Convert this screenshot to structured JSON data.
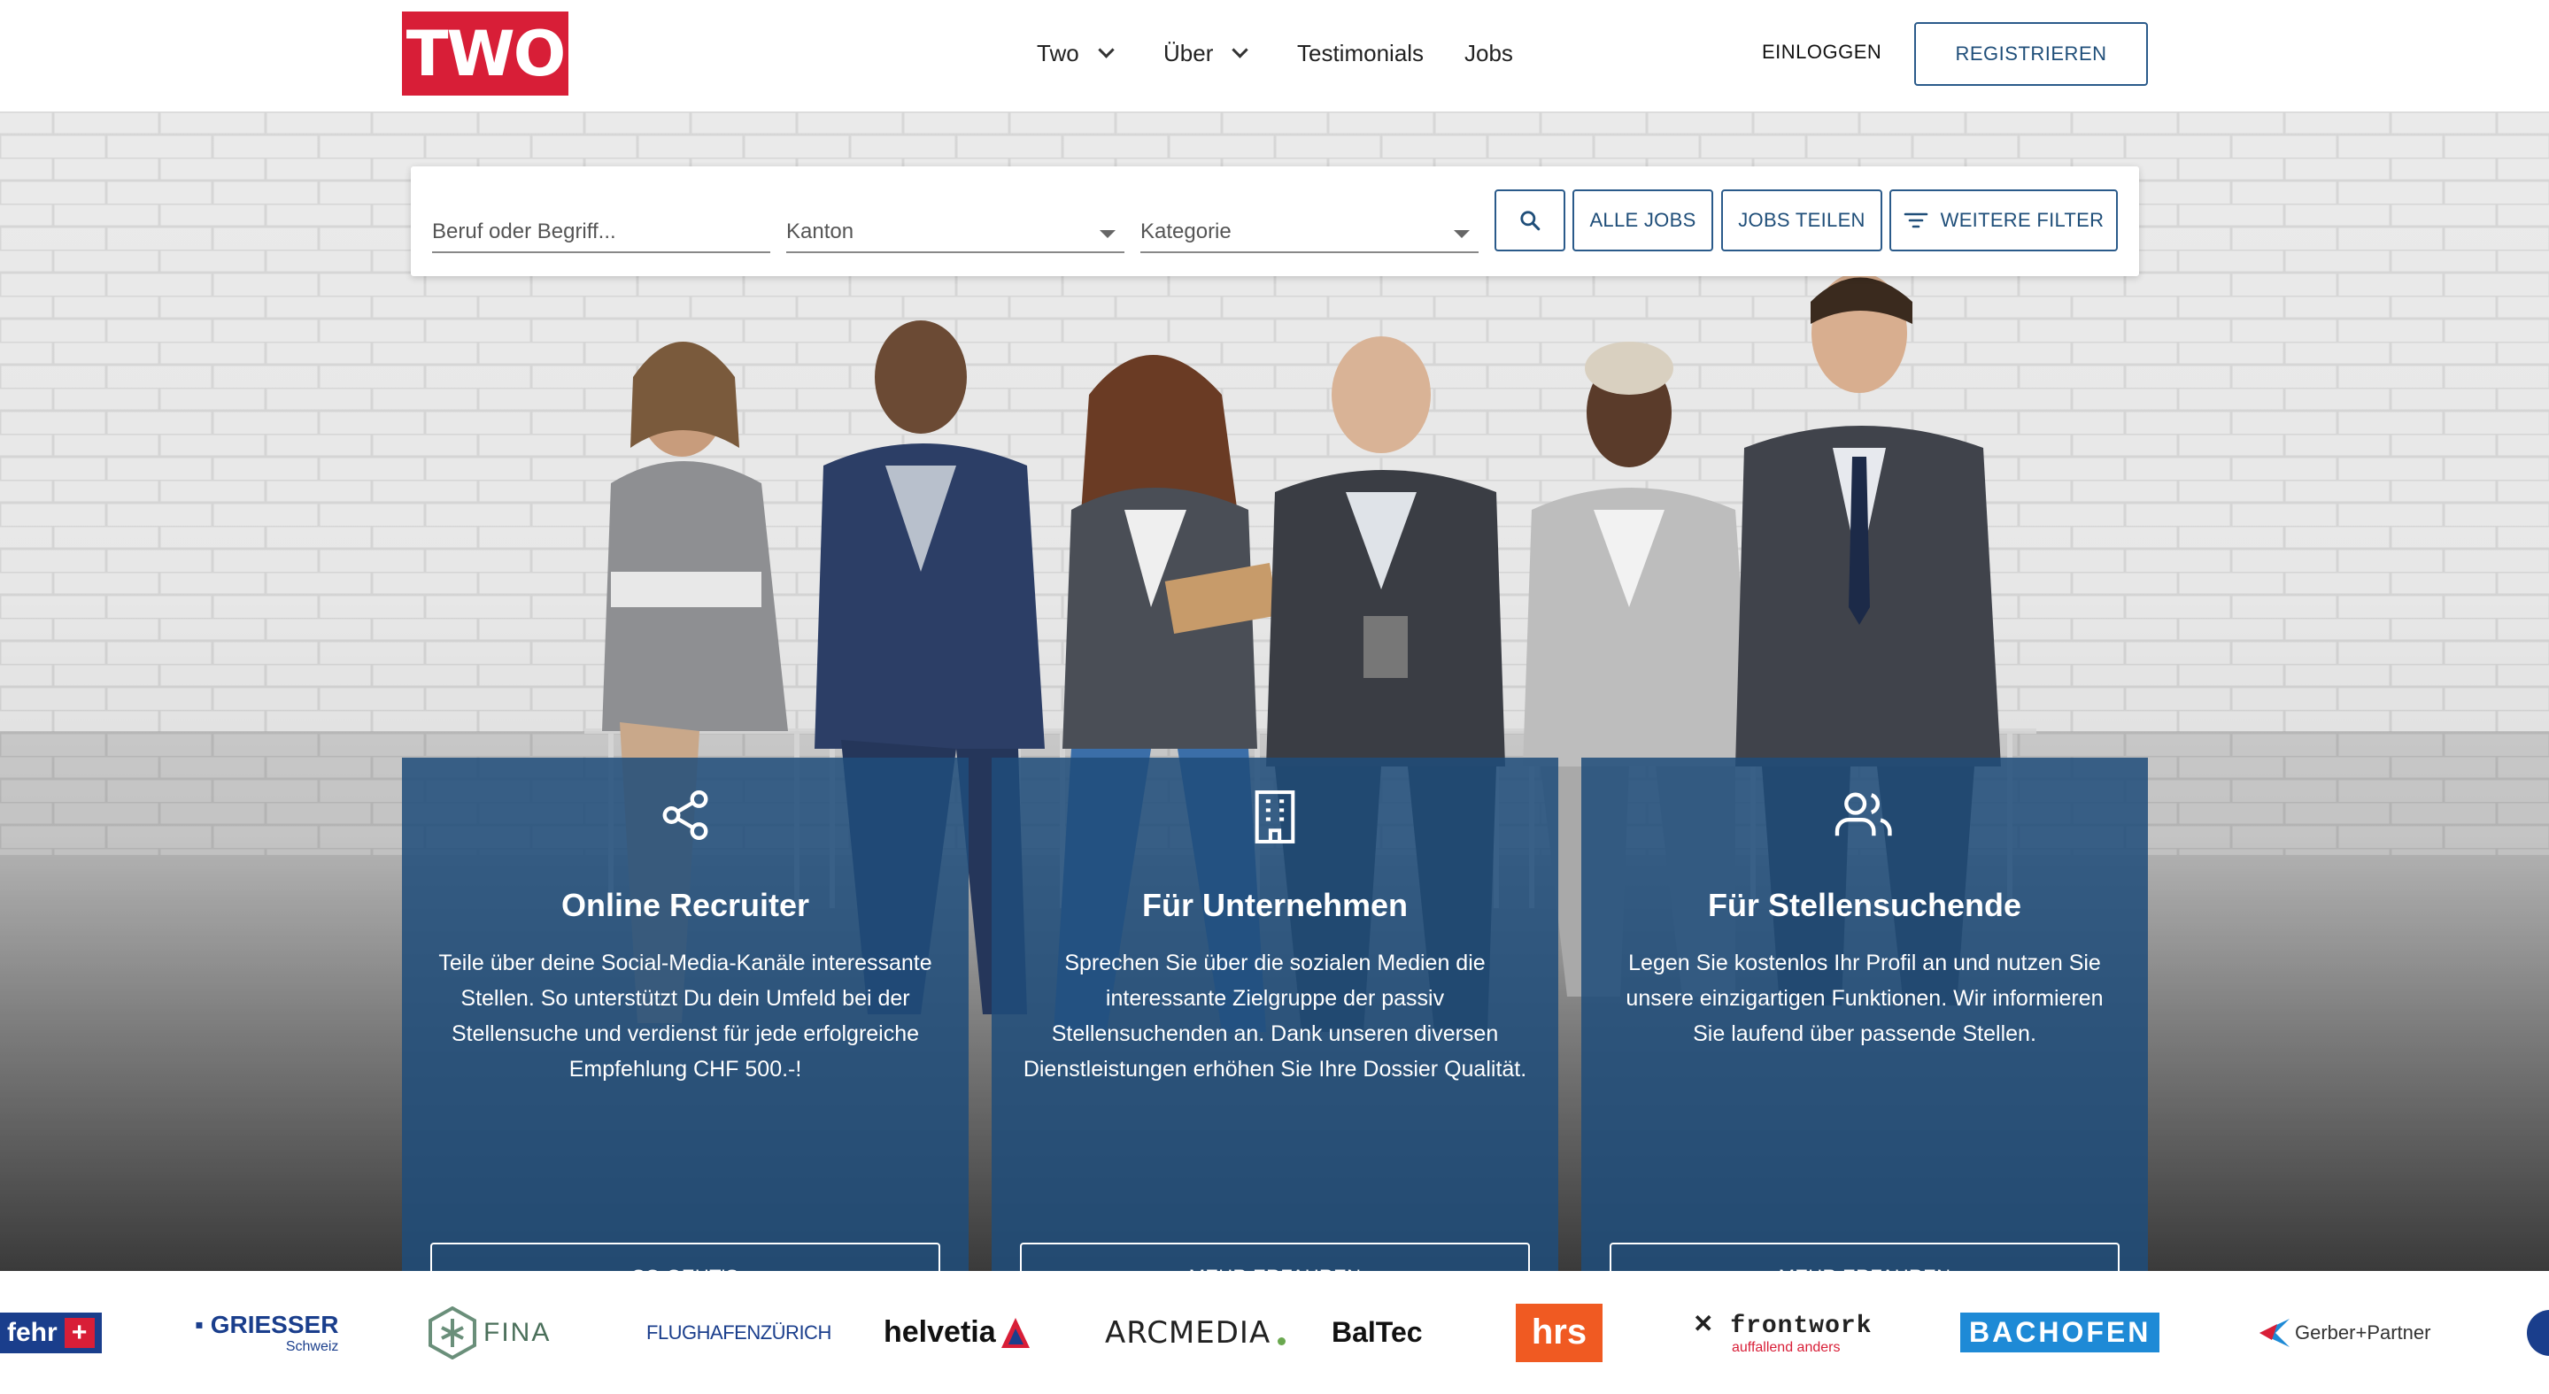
{
  "header": {
    "logo_text": "TWO",
    "nav": [
      {
        "label": "Two",
        "dropdown": true
      },
      {
        "label": "Über",
        "dropdown": true
      },
      {
        "label": "Testimonials",
        "dropdown": false
      },
      {
        "label": "Jobs",
        "dropdown": false
      }
    ],
    "login_label": "EINLOGGEN",
    "register_label": "REGISTRIEREN"
  },
  "search": {
    "keyword_placeholder": "Beruf oder Begriff...",
    "kanton_label": "Kanton",
    "kategorie_label": "Kategorie",
    "search_icon": "search-icon",
    "all_jobs_label": "ALLE JOBS",
    "share_jobs_label": "JOBS TEILEN",
    "more_filters_label": "WEITERE FILTER",
    "filter_icon": "filter-icon"
  },
  "cards": [
    {
      "icon": "share-icon",
      "title": "Online Recruiter",
      "text": "Teile über deine Social-Media-Kanäle interessante Stellen. So unterstützt Du dein Umfeld bei der Stellensuche und verdienst für jede erfolgreiche Empfehlung CHF 500.-!",
      "button": "SO GEHT'S"
    },
    {
      "icon": "building-icon",
      "title": "Für Unternehmen",
      "text": "Sprechen Sie über die sozialen Medien die interessante Zielgruppe der passiv Stellensuchenden an. Dank unseren diversen Dienstleistungen erhöhen Sie Ihre Dossier Qualität.",
      "button": "MEHR ERFAHREN"
    },
    {
      "icon": "users-icon",
      "title": "Für Stellensuchende",
      "text": "Legen Sie kostenlos Ihr Profil an und nutzen Sie unsere einzigartigen Funktionen. Wir informieren Sie laufend über passende Stellen.",
      "button": "MEHR ERFAHREN"
    }
  ],
  "partners": {
    "fehr": "fehr",
    "griesser": "GRIESSER",
    "griesser_sub": "Schweiz",
    "fina": "FINA",
    "flughafen": "FLUGHAFENZÜRICH",
    "helvetia": "helvetia",
    "arcmedia": "ARCMEDIA",
    "baltec": "BalTec",
    "hrs": "hrs",
    "frontwork": "frontwork",
    "frontwork_sub": "auffallend anders",
    "bachofen": "BACHOFEN",
    "gerber": "Gerber+Partner"
  },
  "colors": {
    "brand_red": "#d81e37",
    "accent_blue": "#1f4e79",
    "card_blue": "#1f4d7a"
  }
}
